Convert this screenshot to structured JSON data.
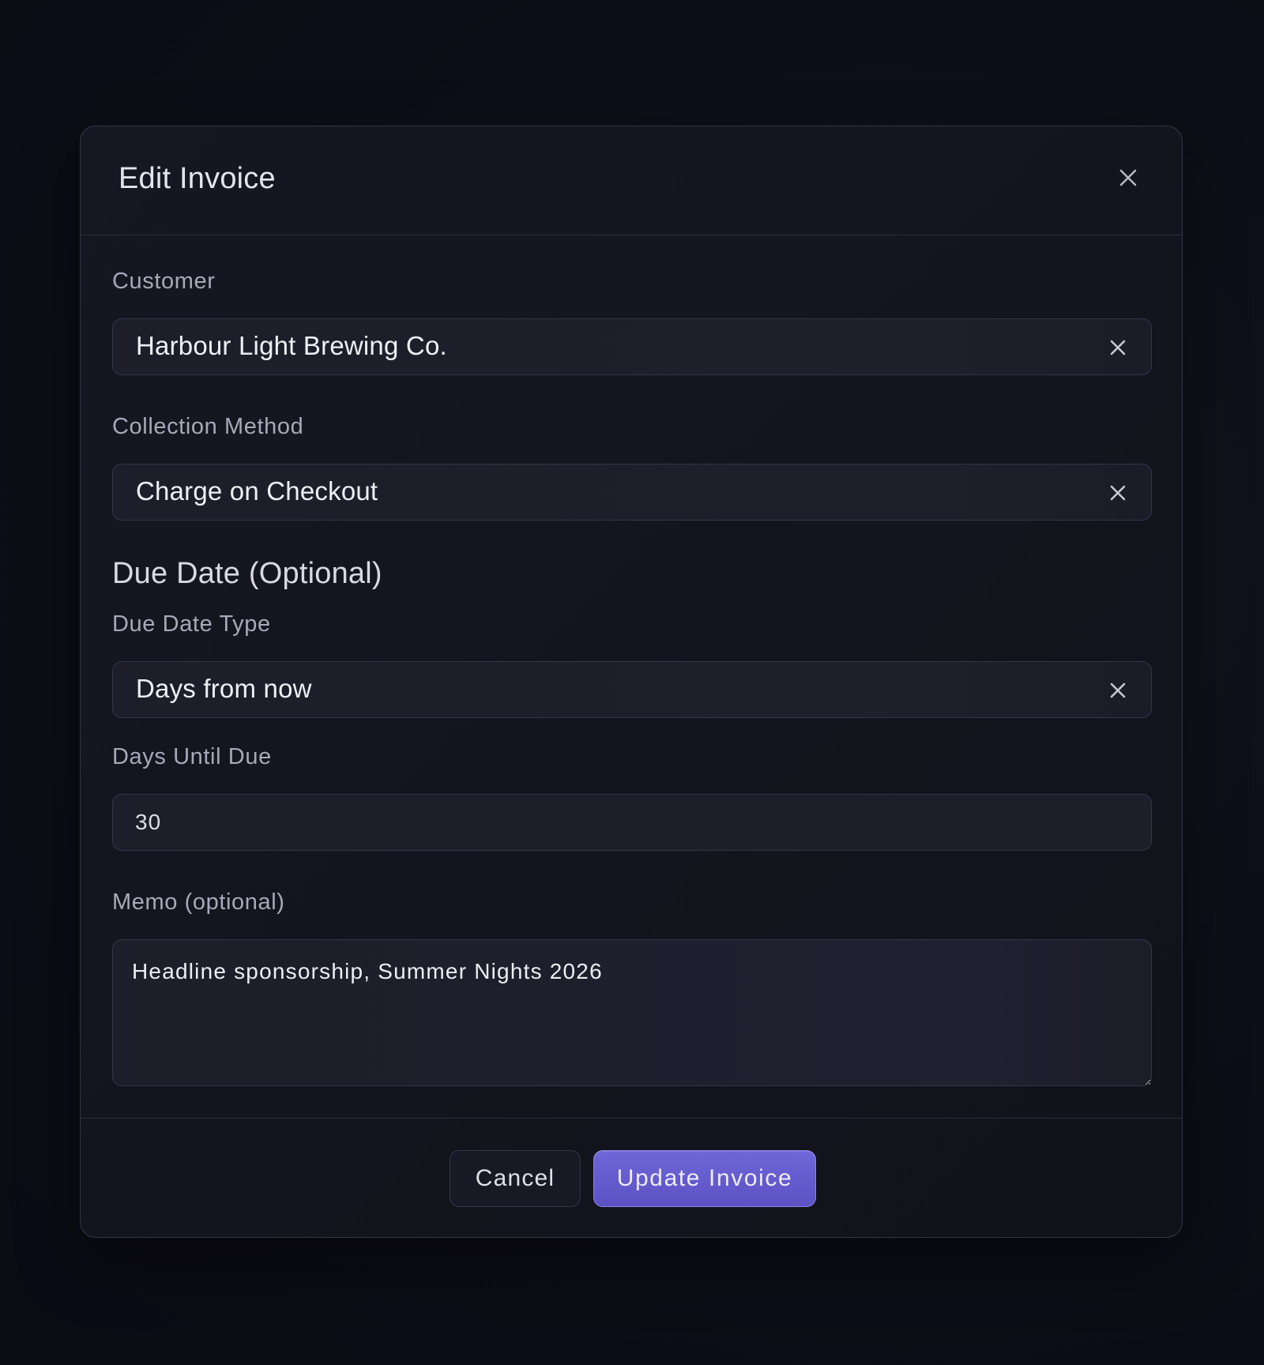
{
  "modal": {
    "title": "Edit Invoice"
  },
  "fields": {
    "customer": {
      "label": "Customer",
      "value": "Harbour Light Brewing Co."
    },
    "collection_method": {
      "label": "Collection Method",
      "value": "Charge on Checkout"
    },
    "due_date_section": {
      "title": "Due Date (Optional)"
    },
    "due_date_type": {
      "label": "Due Date Type",
      "value": "Days from now"
    },
    "days_until_due": {
      "label": "Days Until Due",
      "value": "30"
    },
    "memo": {
      "label": "Memo (optional)",
      "value": "Headline sponsorship, Summer Nights 2026"
    }
  },
  "footer": {
    "cancel_label": "Cancel",
    "submit_label": "Update Invoice"
  },
  "icons": {
    "close": "close-icon",
    "clear": "clear-icon"
  },
  "colors": {
    "accent": "#6a61d4",
    "background": "#0e0e18",
    "panel": "#151620"
  }
}
